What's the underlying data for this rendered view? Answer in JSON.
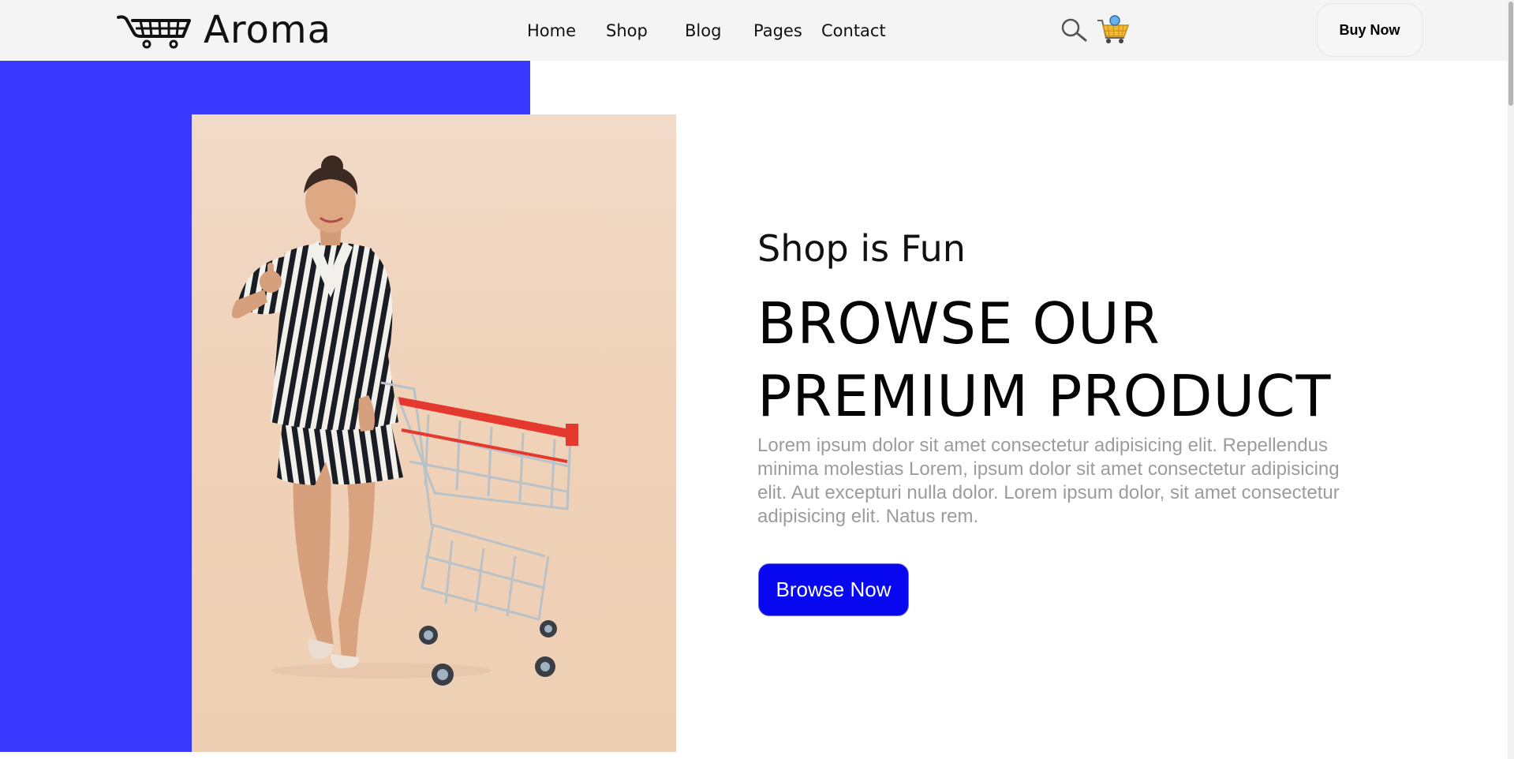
{
  "brand": {
    "name": "Aroma",
    "logo_icon": "shopping-cart-icon"
  },
  "nav": {
    "items": [
      {
        "label": "Home"
      },
      {
        "label": "Shop"
      },
      {
        "label": "Blog"
      },
      {
        "label": "Pages"
      },
      {
        "label": "Contact"
      }
    ]
  },
  "header_actions": {
    "search_icon": "search-icon",
    "cart_icon": "shopping-basket-icon",
    "buy_label": "Buy Now"
  },
  "hero": {
    "subtitle": "Shop is Fun",
    "headline_line1": "BROWSE OUR",
    "headline_line2": "PREMIUM PRODUCT",
    "body": "Lorem ipsum dolor sit amet consectetur adipisicing elit. Repellendus minima molestias Lorem, ipsum dolor sit amet consectetur adipisicing elit. Aut excepturi nulla dolor. Lorem ipsum dolor, sit amet consectetur adipisicing elit. Natus rem.",
    "cta_label": "Browse Now",
    "photo": "woman-with-shopping-cart-photo"
  },
  "colors": {
    "accent_block": "#3838fe",
    "cta_background": "#0808f0",
    "header_background": "#f4f4f4",
    "body_text": "#9c9c9c"
  }
}
